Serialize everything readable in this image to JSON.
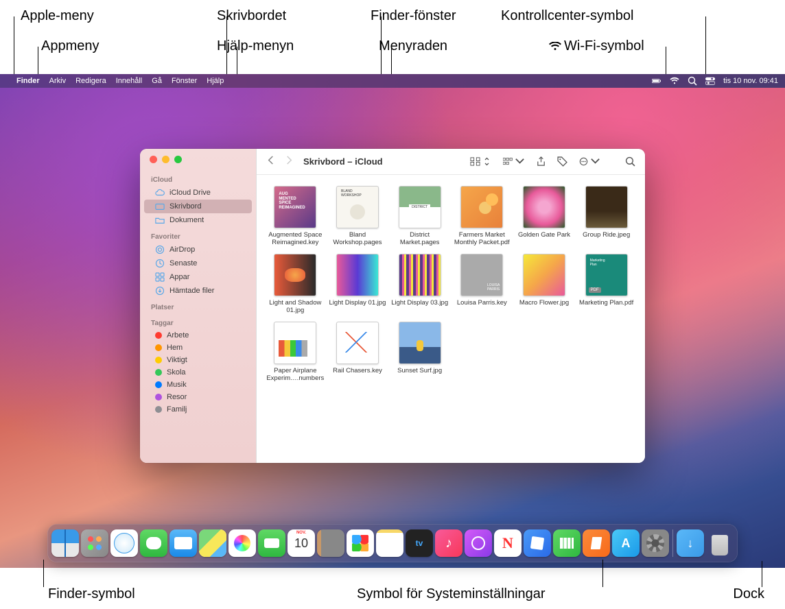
{
  "callouts": {
    "top": {
      "apple_menu": "Apple-meny",
      "app_menu": "Appmeny",
      "desktop": "Skrivbordet",
      "help_menu": "Hjälp-menyn",
      "finder_window": "Finder-fönster",
      "menu_bar": "Menyraden",
      "control_center": "Kontrollcenter-symbol",
      "wifi": "Wi-Fi-symbol"
    },
    "bottom": {
      "finder_icon": "Finder-symbol",
      "syspref": "Symbol för Systeminställningar",
      "dock": "Dock"
    }
  },
  "menubar": {
    "app": "Finder",
    "items": [
      "Arkiv",
      "Redigera",
      "Innehåll",
      "Gå",
      "Fönster",
      "Hjälp"
    ],
    "clock": "tis 10 nov.  09:41"
  },
  "finder": {
    "title": "Skrivbord – iCloud",
    "sidebar": {
      "icloud_head": "iCloud",
      "icloud_items": [
        "iCloud Drive",
        "Skrivbord",
        "Dokument"
      ],
      "fav_head": "Favoriter",
      "fav_items": [
        "AirDrop",
        "Senaste",
        "Appar",
        "Hämtade filer"
      ],
      "places_head": "Platser",
      "tags_head": "Taggar",
      "tags": [
        {
          "label": "Arbete",
          "color": "#ff3b30"
        },
        {
          "label": "Hem",
          "color": "#ff9500"
        },
        {
          "label": "Viktigt",
          "color": "#ffcc00"
        },
        {
          "label": "Skola",
          "color": "#34c759"
        },
        {
          "label": "Musik",
          "color": "#007aff"
        },
        {
          "label": "Resor",
          "color": "#af52de"
        },
        {
          "label": "Familj",
          "color": "#8e8e93"
        }
      ]
    },
    "files": [
      "Augmented Space Reimagined.key",
      "Bland Workshop.pages",
      "District Market.pages",
      "Farmers Market Monthly Packet.pdf",
      "Golden Gate Park",
      "Group Ride.jpeg",
      "Light and Shadow 01.jpg",
      "Light Display 01.jpg",
      "Light Display 03.jpg",
      "Louisa Parris.key",
      "Macro Flower.jpg",
      "Marketing Plan.pdf",
      "Paper Airplane Experim….numbers",
      "Rail Chasers.key",
      "Sunset Surf.jpg"
    ]
  },
  "dock": {
    "calendar_month": "NOV.",
    "calendar_day": "10"
  }
}
